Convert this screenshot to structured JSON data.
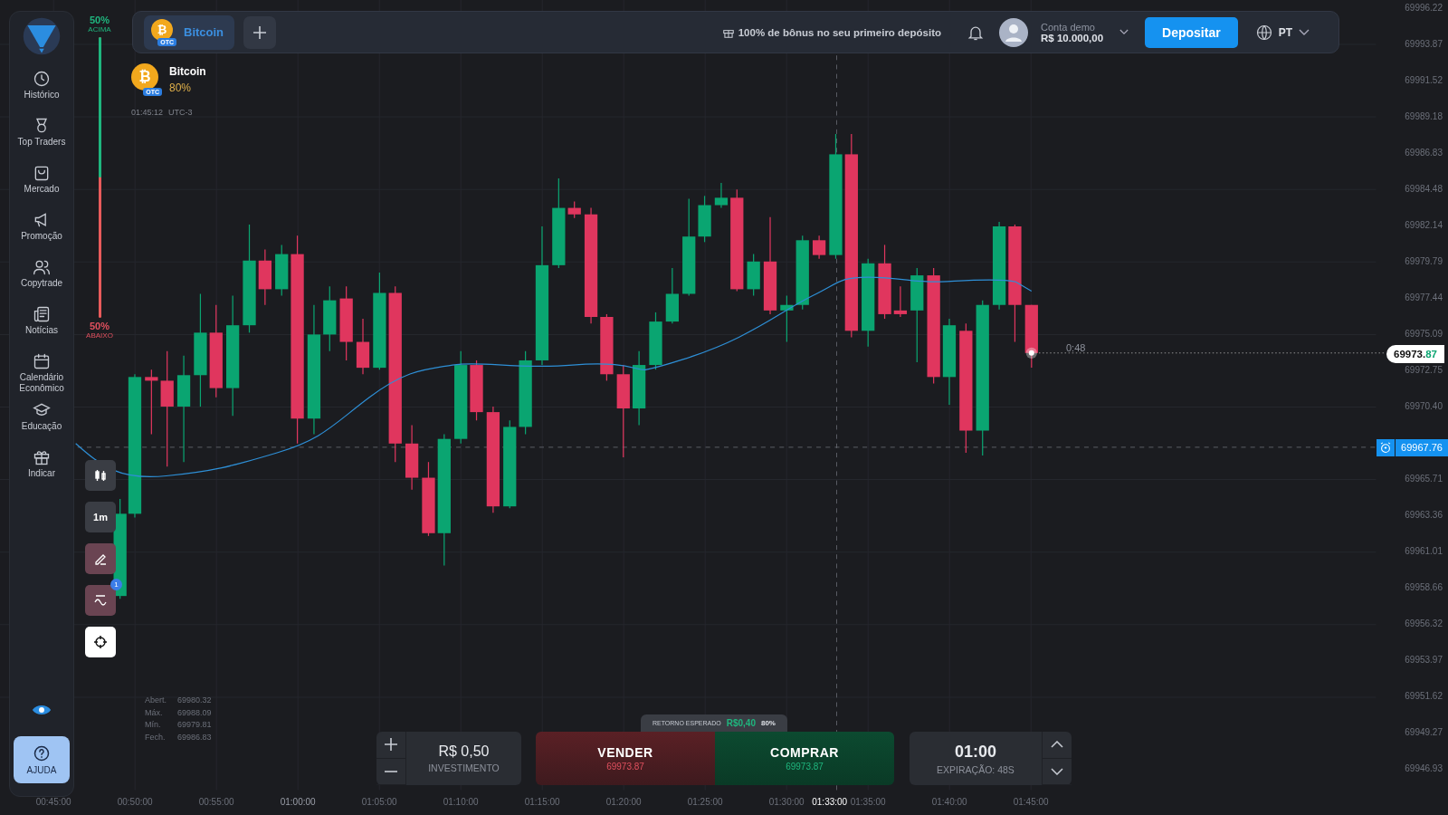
{
  "sidebar": {
    "items": [
      {
        "label": "Histórico",
        "kind": "clock"
      },
      {
        "label": "Top Traders",
        "kind": "medal"
      },
      {
        "label": "Mercado",
        "kind": "bag"
      },
      {
        "label": "Promoção",
        "kind": "megaphone"
      },
      {
        "label": "Copytrade",
        "kind": "users"
      },
      {
        "label": "Notícias",
        "kind": "news"
      },
      {
        "label": "Calendário Econômico",
        "kind": "calendar"
      },
      {
        "label": "Educação",
        "kind": "cap"
      },
      {
        "label": "Indicar",
        "kind": "gift"
      }
    ],
    "help_button": "AJUDA"
  },
  "sentiment": {
    "up_percent": "50%",
    "up_label": "ACIMA",
    "down_percent": "50%",
    "down_label": "ABAIXO",
    "level": 0.5
  },
  "top_bar": {
    "asset_tabs": [
      {
        "name": "Bitcoin",
        "symbol": "₿",
        "badge": "OTC",
        "selected": true
      }
    ],
    "bonus": "100% de bônus no seu primeiro depósito",
    "account": {
      "label": "Conta demo",
      "balance": "R$ 10.000,00"
    },
    "deposit_button": "Depositar",
    "language": "PT"
  },
  "asset": {
    "name": "Bitcoin",
    "symbol": "₿",
    "badge": "OTC",
    "payout": "80%",
    "time": "01:45:12",
    "timezone": "UTC-3"
  },
  "chart": {
    "price_axis": [
      {
        "kind": "tick",
        "label": "69996.22"
      },
      {
        "kind": "tick",
        "label": "69993.87"
      },
      {
        "kind": "tick",
        "label": "69991.52"
      },
      {
        "kind": "tick",
        "label": "69989.18"
      },
      {
        "kind": "tick",
        "label": "69986.83"
      },
      {
        "kind": "tick",
        "label": "69984.48"
      },
      {
        "kind": "tick",
        "label": "69982.14"
      },
      {
        "kind": "tick",
        "label": "69979.79"
      },
      {
        "kind": "tick",
        "label": "69977.44"
      },
      {
        "kind": "tick",
        "label": "69975.09"
      },
      {
        "kind": "tick",
        "label": "69972.75"
      },
      {
        "kind": "tick",
        "label": "69970.40"
      },
      {
        "kind": "alert",
        "label": "69967.76"
      },
      {
        "kind": "tick",
        "label": "69965.71"
      },
      {
        "kind": "tick",
        "label": "69963.36"
      },
      {
        "kind": "tick",
        "label": "69961.01"
      },
      {
        "kind": "tick",
        "label": "69958.66"
      },
      {
        "kind": "tick",
        "label": "69956.32"
      },
      {
        "kind": "tick",
        "label": "69953.97"
      },
      {
        "kind": "tick",
        "label": "69951.62"
      },
      {
        "kind": "tick",
        "label": "69949.27"
      },
      {
        "kind": "tick",
        "label": "69946.93"
      }
    ],
    "time_axis": [
      {
        "label": "00:45:00",
        "kind": "tick"
      },
      {
        "label": "00:50:00",
        "kind": "tick"
      },
      {
        "label": "00:55:00",
        "kind": "tick"
      },
      {
        "label": "01:00:00",
        "kind": "hour"
      },
      {
        "label": "01:05:00",
        "kind": "tick"
      },
      {
        "label": "01:10:00",
        "kind": "tick"
      },
      {
        "label": "01:15:00",
        "kind": "tick"
      },
      {
        "label": "01:20:00",
        "kind": "tick"
      },
      {
        "label": "01:25:00",
        "kind": "tick"
      },
      {
        "label": "01:30:00",
        "kind": "tick"
      },
      {
        "label": "01:33:00",
        "kind": "cursor"
      },
      {
        "label": "01:35:00",
        "kind": "tick"
      },
      {
        "label": "01:40:00",
        "kind": "tick"
      },
      {
        "label": "01:45:00",
        "kind": "tick"
      }
    ],
    "current_price": {
      "integer": "69973.",
      "fraction": "87"
    },
    "countdown": "0:48"
  },
  "tools": [
    {
      "kind": "candles",
      "selected": false
    },
    {
      "kind": "interval",
      "label": "1m",
      "selected": false
    },
    {
      "kind": "draw",
      "selected": false
    },
    {
      "kind": "indicator",
      "badge": "1",
      "selected": false
    },
    {
      "kind": "crosshair",
      "selected": true
    }
  ],
  "ohlc": [
    {
      "label": "Abert.",
      "value": "69980.32"
    },
    {
      "label": "Máx.",
      "value": "69988.09"
    },
    {
      "label": "Mín.",
      "value": "69979.81"
    },
    {
      "label": "Fech.",
      "value": "69986.83"
    }
  ],
  "trade": {
    "investment": {
      "value": "R$ 0,50",
      "label": "INVESTIMENTO"
    },
    "expected_return": {
      "label": "RETORNO ESPERADO",
      "amount": "R$0,40",
      "percent": "80%"
    },
    "sell": {
      "label": "VENDER",
      "price": "69973.87"
    },
    "buy": {
      "label": "COMPRAR",
      "price": "69973.87"
    },
    "expiry": {
      "time": "01:00",
      "label": "EXPIRAÇÃO: 48S"
    }
  }
}
